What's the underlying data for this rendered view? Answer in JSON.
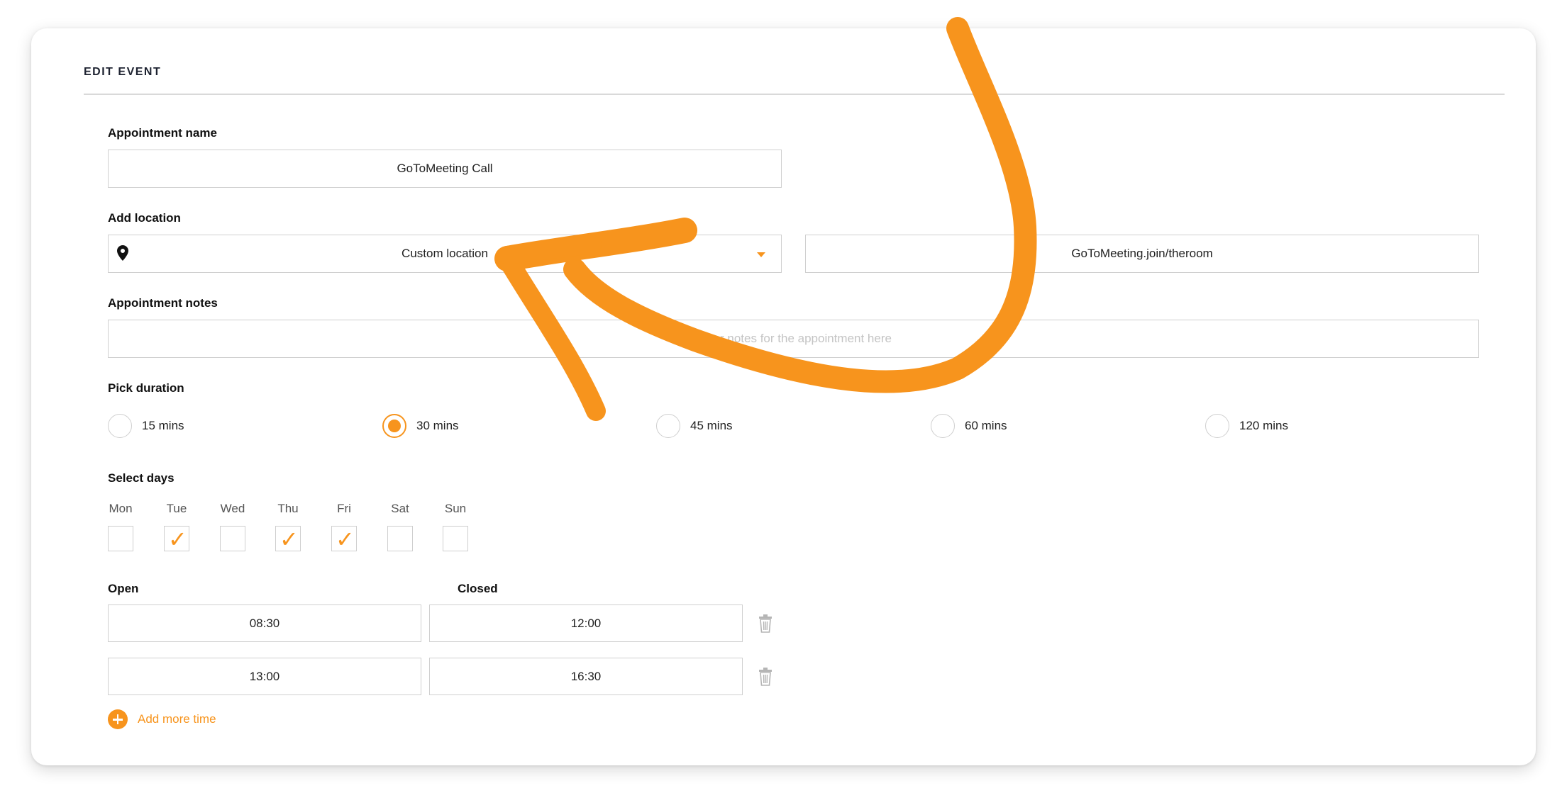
{
  "header": {
    "title": "EDIT EVENT"
  },
  "appointment_name": {
    "label": "Appointment name",
    "value": "GoToMeeting Call"
  },
  "location": {
    "label": "Add location",
    "type_value": "Custom location",
    "custom_value": "GoToMeeting.join/theroom",
    "icon": "map-pin-icon"
  },
  "notes": {
    "label": "Appointment notes",
    "placeholder": "Enter notes for the appointment here"
  },
  "duration": {
    "label": "Pick duration",
    "options": [
      "15 mins",
      "30 mins",
      "45 mins",
      "60 mins",
      "120 mins"
    ],
    "selected": "30 mins"
  },
  "days": {
    "label": "Select days",
    "items": [
      {
        "name": "Mon",
        "checked": false
      },
      {
        "name": "Tue",
        "checked": true
      },
      {
        "name": "Wed",
        "checked": false
      },
      {
        "name": "Thu",
        "checked": true
      },
      {
        "name": "Fri",
        "checked": true
      },
      {
        "name": "Sat",
        "checked": false
      },
      {
        "name": "Sun",
        "checked": false
      }
    ]
  },
  "hours": {
    "open_label": "Open",
    "closed_label": "Closed",
    "rows": [
      {
        "open": "08:30",
        "closed": "12:00"
      },
      {
        "open": "13:00",
        "closed": "16:30"
      }
    ]
  },
  "add_more": {
    "label": "Add more time"
  },
  "colors": {
    "accent": "#f7941d",
    "border": "#cfcfcf"
  }
}
